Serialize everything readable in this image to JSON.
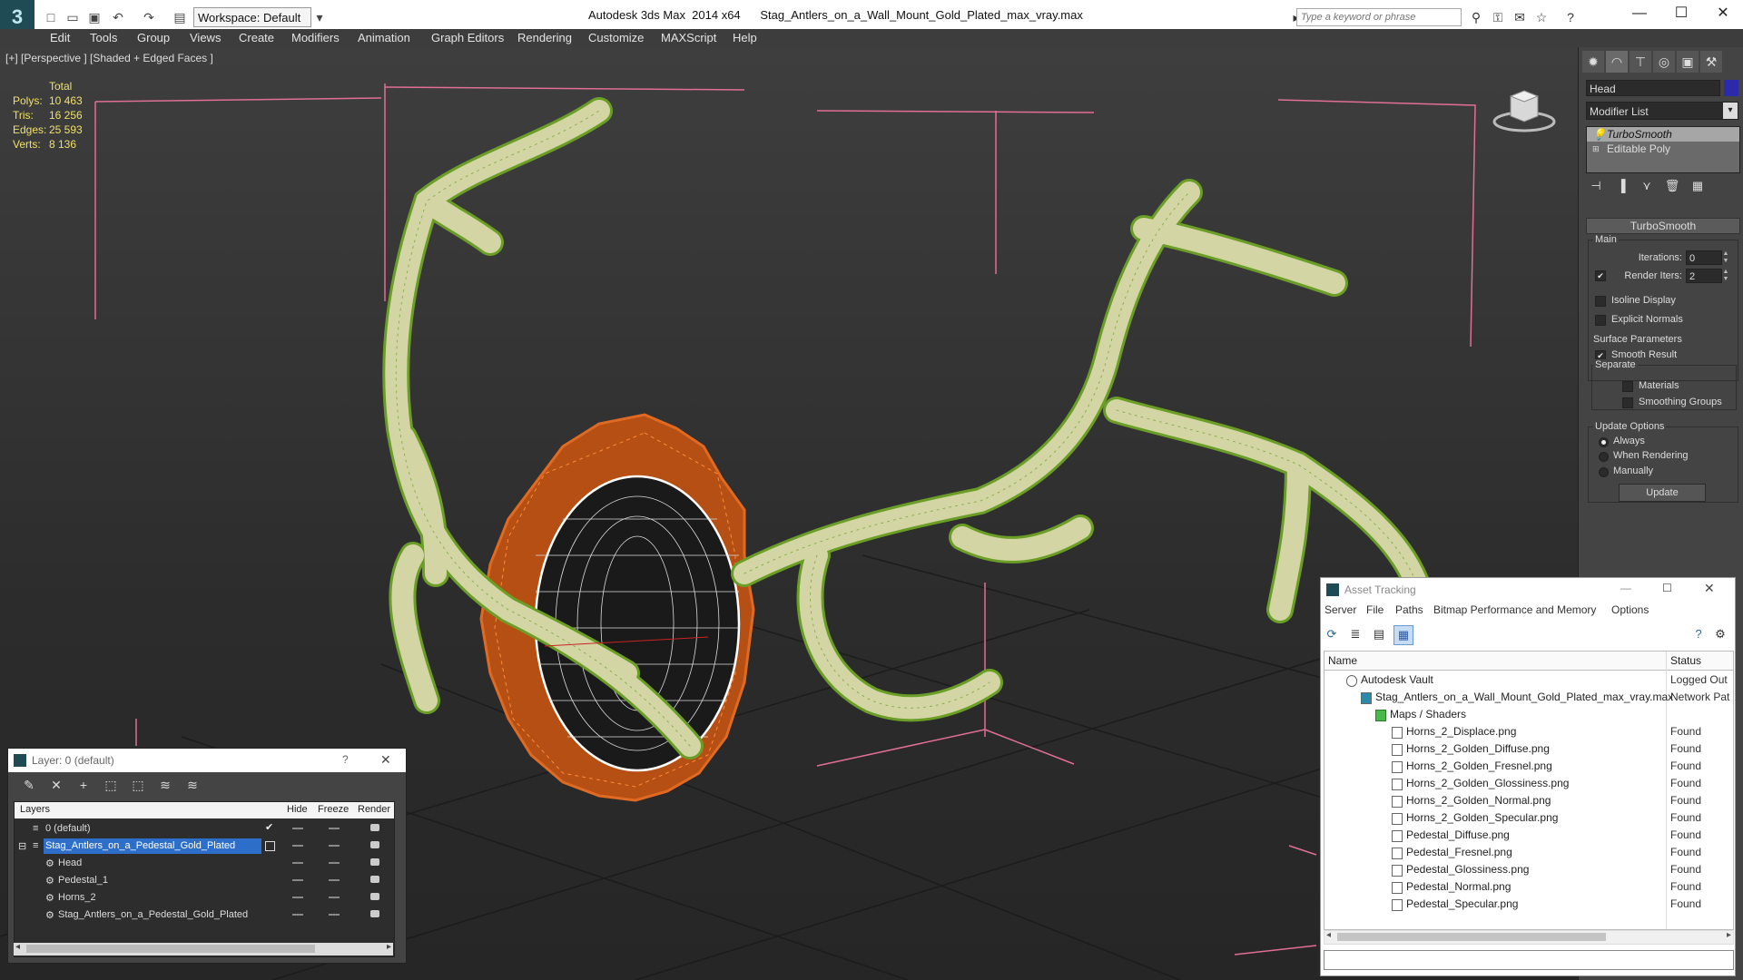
{
  "app": {
    "logo_glyph": "3",
    "workspace": "Workspace: Default",
    "title": "Autodesk 3ds Max  2014 x64      Stag_Antlers_on_a_Wall_Mount_Gold_Plated_max_vray.max",
    "search_placeholder": "Type a keyword or phrase",
    "minimize": "—",
    "maximize": "☐",
    "close": "✕"
  },
  "menu": [
    "Edit",
    "Tools",
    "Group",
    "Views",
    "Create",
    "Modifiers",
    "Animation",
    "Graph Editors",
    "Rendering",
    "Customize",
    "MAXScript",
    "Help"
  ],
  "viewport": {
    "label": "[+] [Perspective ] [Shaded + Edged Faces ]",
    "stats": {
      "header": "Total",
      "rows": [
        {
          "label": "Polys:",
          "value": "10 463"
        },
        {
          "label": "Tris:",
          "value": "16 256"
        },
        {
          "label": "Edges:",
          "value": "25 593"
        },
        {
          "label": "Verts:",
          "value": "8 136"
        }
      ]
    }
  },
  "command_panel": {
    "object_name": "Head",
    "object_color": "#2a2aaa",
    "modifier_list": "Modifier List",
    "stack": [
      "TurboSmooth",
      "Editable Poly"
    ],
    "rollout_title": "TurboSmooth",
    "main_group": "Main",
    "iterations_label": "Iterations:",
    "iterations_value": "0",
    "render_iters_label": "Render Iters:",
    "render_iters_value": "2",
    "render_iters_checked": "✔",
    "isoline_label": "Isoline Display",
    "explicit_label": "Explicit Normals",
    "surface_group": "Surface Parameters",
    "smooth_label": "Smooth Result",
    "smooth_checked": "✔",
    "separate_label": "Separate",
    "materials_label": "Materials",
    "smoothing_groups_label": "Smoothing Groups",
    "update_group": "Update Options",
    "always_label": "Always",
    "when_rendering_label": "When Rendering",
    "manually_label": "Manually",
    "update_button": "Update"
  },
  "asset_tracking": {
    "title": "Asset Tracking",
    "menu": [
      "Server",
      "File",
      "Paths",
      "Bitmap Performance and Memory",
      "Options"
    ],
    "col_name": "Name",
    "col_status": "Status",
    "rows": [
      {
        "name": "Autodesk Vault",
        "status": "Logged Out"
      },
      {
        "name": "Stag_Antlers_on_a_Wall_Mount_Gold_Plated_max_vray.max",
        "status": "Network Pat"
      },
      {
        "name": "Maps / Shaders",
        "status": ""
      },
      {
        "name": "Horns_2_Displace.png",
        "status": "Found"
      },
      {
        "name": "Horns_2_Golden_Diffuse.png",
        "status": "Found"
      },
      {
        "name": "Horns_2_Golden_Fresnel.png",
        "status": "Found"
      },
      {
        "name": "Horns_2_Golden_Glossiness.png",
        "status": "Found"
      },
      {
        "name": "Horns_2_Golden_Normal.png",
        "status": "Found"
      },
      {
        "name": "Horns_2_Golden_Specular.png",
        "status": "Found"
      },
      {
        "name": "Pedestal_Diffuse.png",
        "status": "Found"
      },
      {
        "name": "Pedestal_Fresnel.png",
        "status": "Found"
      },
      {
        "name": "Pedestal_Glossiness.png",
        "status": "Found"
      },
      {
        "name": "Pedestal_Normal.png",
        "status": "Found"
      },
      {
        "name": "Pedestal_Specular.png",
        "status": "Found"
      }
    ]
  },
  "layer_manager": {
    "title": "Layer: 0 (default)",
    "help": "?",
    "close": "✕",
    "col_layers": "Layers",
    "col_hide": "Hide",
    "col_freeze": "Freeze",
    "col_render": "Render",
    "rows": [
      {
        "name": "0 (default)"
      },
      {
        "name": "Stag_Antlers_on_a_Pedestal_Gold_Plated"
      },
      {
        "name": "Head"
      },
      {
        "name": "Pedestal_1"
      },
      {
        "name": "Horns_2"
      },
      {
        "name": "Stag_Antlers_on_a_Pedestal_Gold_Plated"
      }
    ]
  }
}
